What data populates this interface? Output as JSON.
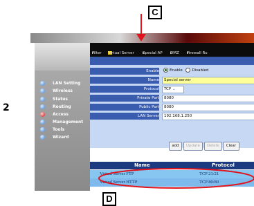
{
  "step_number": "2",
  "callouts": {
    "top": "C",
    "bottom": "D"
  },
  "nav": {
    "items": [
      {
        "label": "Filter"
      },
      {
        "label": "Virtual Server"
      },
      {
        "label": "Special AP"
      },
      {
        "label": "DMZ"
      },
      {
        "label": "Firewall Ru"
      }
    ]
  },
  "sidebar": {
    "items": [
      {
        "label": "LAN Setting"
      },
      {
        "label": "Wireless"
      },
      {
        "label": "Status"
      },
      {
        "label": "Routing"
      },
      {
        "label": "Access"
      },
      {
        "label": "Management"
      },
      {
        "label": "Tools"
      },
      {
        "label": "Wizard"
      }
    ]
  },
  "form": {
    "enable": {
      "label": "Enable",
      "opt_enable": "Enable",
      "opt_disable": "Disabled"
    },
    "name": {
      "label": "Name",
      "value": "Special server"
    },
    "protocol": {
      "label": "Protocol",
      "value": "TCP"
    },
    "private_port": {
      "label": "Private Port",
      "value": "8080"
    },
    "public_port": {
      "label": "Public Port",
      "value": "8080"
    },
    "lan_server": {
      "label": "LAN Server",
      "value": "192.168.1.250"
    }
  },
  "buttons": {
    "add": "add",
    "update": "Update",
    "delete": "Delete",
    "clear": "Clear"
  },
  "table": {
    "headers": {
      "name": "Name",
      "protocol": "Protocol"
    },
    "rows": [
      {
        "name": "Virtual Server FTP",
        "protocol": "TCP 21/21"
      },
      {
        "name": "Virtual Server HTTP",
        "protocol": "TCP 80/80"
      }
    ]
  },
  "colors": {
    "annotation": "#e0141c",
    "nav_bg": "#0c0c0c",
    "band": "#3a5cae"
  }
}
